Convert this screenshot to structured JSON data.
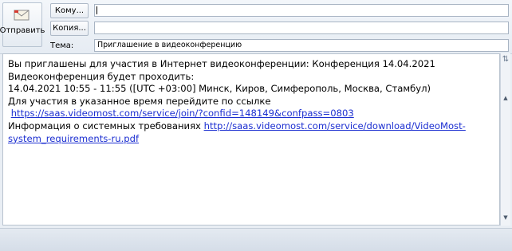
{
  "compose": {
    "send_label": "Отправить",
    "to_label": "Кому...",
    "to_value": "",
    "cc_label": "Копия...",
    "cc_value": "",
    "subject_label": "Тема:",
    "subject_value": "Приглашение в видеоконференцию"
  },
  "message": {
    "line1": "Вы приглашены для участия в Интернет видеоконференции: Конференция 14.04.2021",
    "line2": " Видеоконференция будет проходить:",
    "line3": " 14.04.2021 10:55 - 11:55 ([UTC +03:00] Минск, Киров, Симферополь, Москва, Стамбул)",
    "line4": " Для участия в указанное время перейдите по ссылке",
    "join_link": "https://saas.videomost.com/service/join/?confid=148149&confpass=0803",
    "sysreq_prefix": "Информация о системных требованиях ",
    "sysreq_link_part1": "http://saas.videomost.com/service/download/VideoMost-",
    "sysreq_link_part2": "system_requirements-ru.pdf"
  },
  "colors": {
    "link": "#1c2fd1",
    "chrome": "#e9eef4"
  }
}
